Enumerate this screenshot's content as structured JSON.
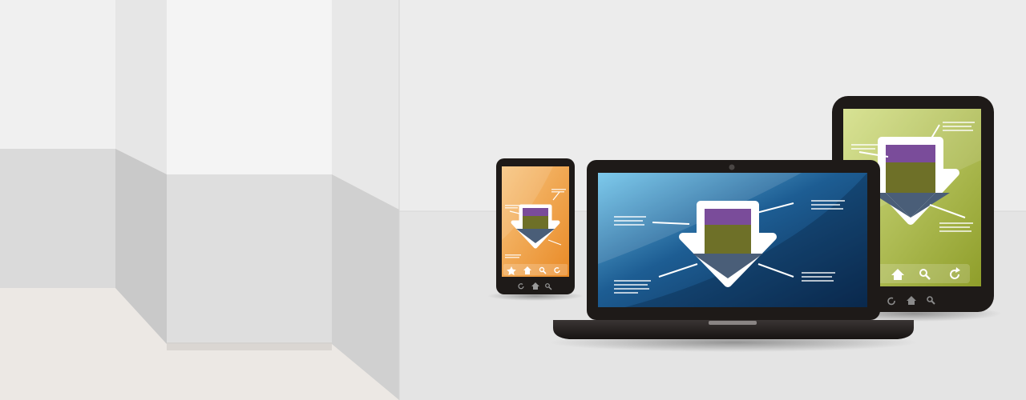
{
  "scene": {
    "description_free": true,
    "colors": {
      "background_floor": "#ece8e4",
      "wall_light": "#f2f2f2",
      "wall_mid": "#dcdcdc",
      "panel_right": "#ececec",
      "device_frame": "#1e1a18",
      "laptop_screen_dark": "#0c2d55",
      "laptop_screen_light": "#6cc3ea",
      "phone_screen": "#f0a044",
      "tablet_screen": "#a8b83a",
      "arrow_purple": "#7a4c9a",
      "arrow_olive": "#6e7028",
      "arrow_slate": "#4a5e78"
    },
    "icons": {
      "phone_toolbar": [
        "star-icon",
        "home-icon",
        "search-icon",
        "refresh-icon"
      ],
      "phone_buttons": [
        "refresh-icon",
        "home-icon",
        "search-icon"
      ],
      "tablet_toolbar": [
        "home-icon",
        "search-icon",
        "refresh-icon"
      ],
      "tablet_buttons": [
        "refresh-icon",
        "home-icon",
        "search-icon"
      ]
    }
  }
}
